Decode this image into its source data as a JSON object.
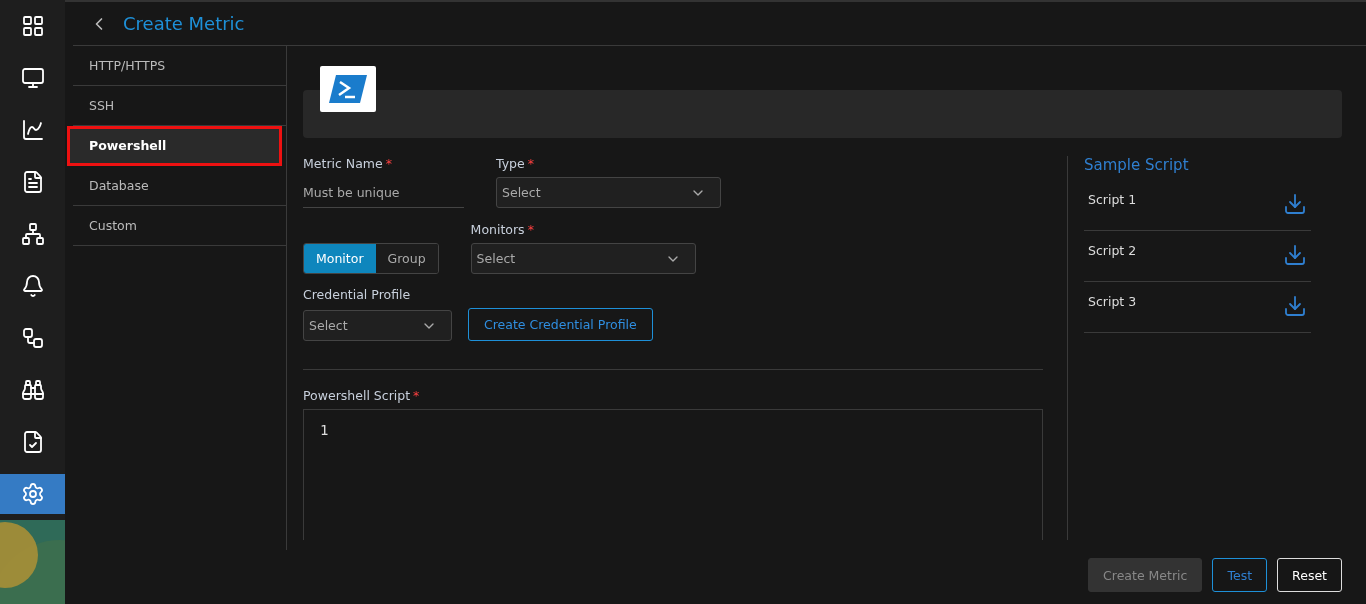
{
  "rail": [
    {
      "selected": false
    },
    {
      "selected": false
    },
    {
      "selected": false
    },
    {
      "selected": false
    },
    {
      "selected": false
    },
    {
      "selected": false
    },
    {
      "selected": false
    },
    {
      "selected": false
    },
    {
      "selected": false
    },
    {
      "selected": true
    }
  ],
  "header": {
    "title": "Create Metric"
  },
  "categories": [
    {
      "label": "HTTP/HTTPS",
      "selected": false
    },
    {
      "label": "SSH",
      "selected": false
    },
    {
      "label": "Powershell",
      "selected": true
    },
    {
      "label": "Database",
      "selected": false
    },
    {
      "label": "Custom",
      "selected": false
    }
  ],
  "form": {
    "metric_name": {
      "label": "Metric Name",
      "required_mark": "*",
      "placeholder": "Must be unique"
    },
    "type": {
      "label": "Type",
      "required_mark": "*",
      "placeholder": "Select"
    },
    "target_toggle": [
      {
        "label": "Monitor",
        "selected": true
      },
      {
        "label": "Group",
        "selected": false
      }
    ],
    "monitors": {
      "label": "Monitors",
      "required_mark": "*",
      "placeholder": "Select"
    },
    "credential_profile": {
      "label": "Credential Profile",
      "placeholder": "Select"
    },
    "create_credential_button": "Create Credential Profile",
    "script": {
      "label": "Powershell Script",
      "required_mark": "*",
      "line_numbers": [
        "1"
      ]
    }
  },
  "sample_script": {
    "title": "Sample Script",
    "items": [
      "Script 1",
      "Script 2",
      "Script 3"
    ]
  },
  "actions": [
    {
      "label": "Create Metric",
      "kind": "disabled"
    },
    {
      "label": "Test",
      "kind": "outline"
    },
    {
      "label": "Reset",
      "kind": "plain"
    }
  ]
}
